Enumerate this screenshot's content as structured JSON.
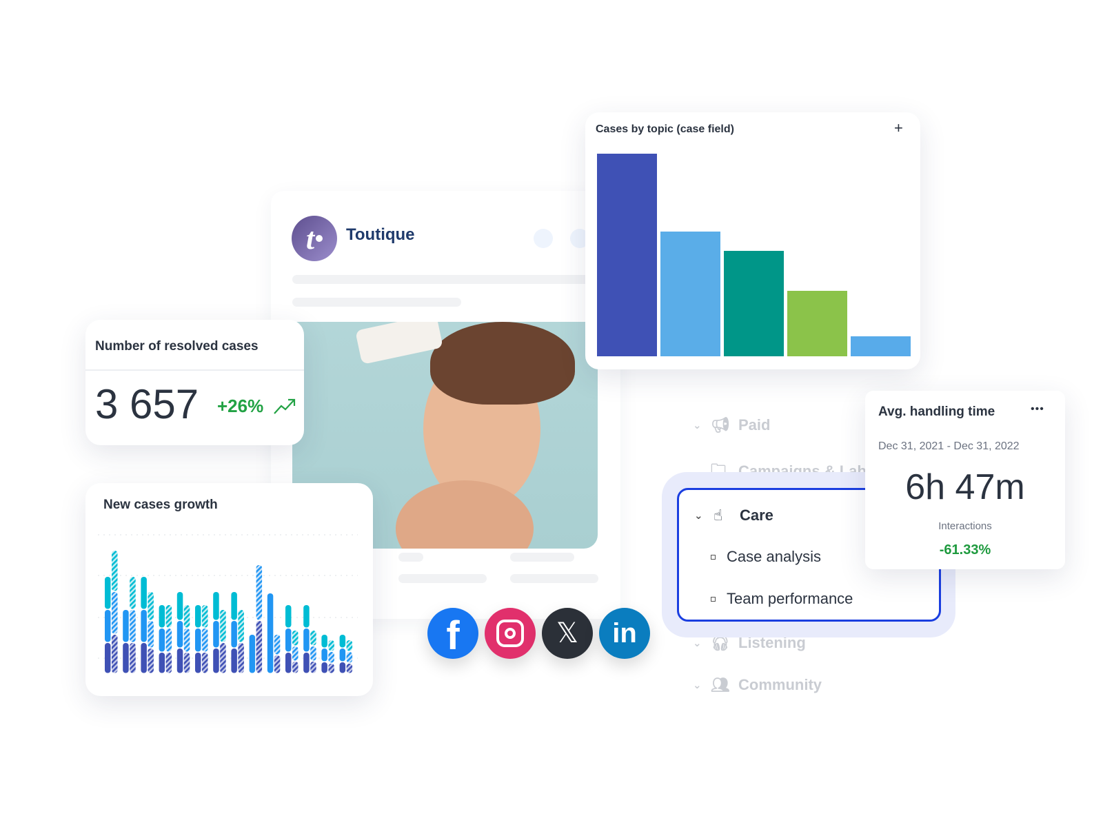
{
  "post": {
    "brand": "Toutique",
    "logo_letter": "t"
  },
  "resolved": {
    "title": "Number of resolved cases",
    "value": "3 657",
    "change": "+26%",
    "trend_icon": "trending-up-icon",
    "change_color": "#22a244"
  },
  "topic_chart": {
    "title": "Cases by topic (case field)",
    "add_label": "+"
  },
  "growth": {
    "title": "New cases growth"
  },
  "nav": {
    "items": [
      {
        "label": "Paid",
        "icon": "megaphone-icon"
      },
      {
        "label": "Campaigns & Lab",
        "icon": "folder-icon"
      },
      {
        "label": "Listening",
        "icon": "headphones-icon"
      },
      {
        "label": "Community",
        "icon": "people-icon"
      }
    ],
    "care": {
      "label": "Care",
      "icon": "care-icon",
      "subitems": [
        "Case analysis",
        "Team performance"
      ]
    }
  },
  "handling": {
    "title": "Avg. handling time",
    "menu": "•••",
    "date_range": "Dec 31, 2021 - Dec 31, 2022",
    "value": "6h 47m",
    "label": "Interactions",
    "change": "-61.33%",
    "change_color": "#1e9a3e"
  },
  "social": [
    "facebook",
    "instagram",
    "x",
    "linkedin"
  ],
  "chart_data": [
    {
      "type": "bar",
      "title": "Cases by topic (case field)",
      "values": [
        294,
        181,
        153,
        95,
        29
      ],
      "colors": [
        "#3f51b5",
        "#5aade8",
        "#009688",
        "#8bc34a",
        "#58abea"
      ]
    },
    {
      "type": "bar",
      "title": "New cases growth",
      "stacked": true,
      "segment_colors": [
        "#3f51b5",
        "#2196f3",
        "#00bcd4"
      ],
      "groups": [
        {
          "solid": [
            45,
            48,
            48
          ],
          "hatched": [
            57,
            62,
            60
          ]
        },
        {
          "solid": [
            45,
            48,
            0
          ],
          "hatched": [
            45,
            48,
            48
          ]
        },
        {
          "solid": [
            45,
            48,
            48
          ],
          "hatched": [
            37,
            40,
            42
          ]
        },
        {
          "solid": [
            31,
            35,
            34
          ],
          "hatched": [
            31,
            35,
            34
          ]
        },
        {
          "solid": [
            37,
            40,
            42
          ],
          "hatched": [
            31,
            35,
            34
          ]
        },
        {
          "solid": [
            31,
            35,
            34
          ],
          "hatched": [
            31,
            35,
            34
          ]
        },
        {
          "solid": [
            37,
            40,
            42
          ],
          "hatched": [
            45,
            0,
            48
          ]
        },
        {
          "solid": [
            37,
            40,
            42
          ],
          "hatched": [
            45,
            0,
            48
          ]
        },
        {
          "solid": [
            0,
            57,
            0
          ],
          "hatched": [
            77,
            81,
            0
          ]
        },
        {
          "solid": [
            0,
            117,
            0
          ],
          "hatched": [
            27,
            30,
            0
          ]
        },
        {
          "solid": [
            31,
            35,
            34
          ],
          "hatched": [
            18,
            22,
            23
          ]
        },
        {
          "solid": [
            31,
            35,
            34
          ],
          "hatched": [
            18,
            22,
            23
          ]
        },
        {
          "solid": [
            17,
            20,
            20
          ],
          "hatched": [
            15,
            17,
            17
          ]
        },
        {
          "solid": [
            17,
            20,
            20
          ],
          "hatched": [
            15,
            17,
            17
          ]
        }
      ]
    }
  ]
}
